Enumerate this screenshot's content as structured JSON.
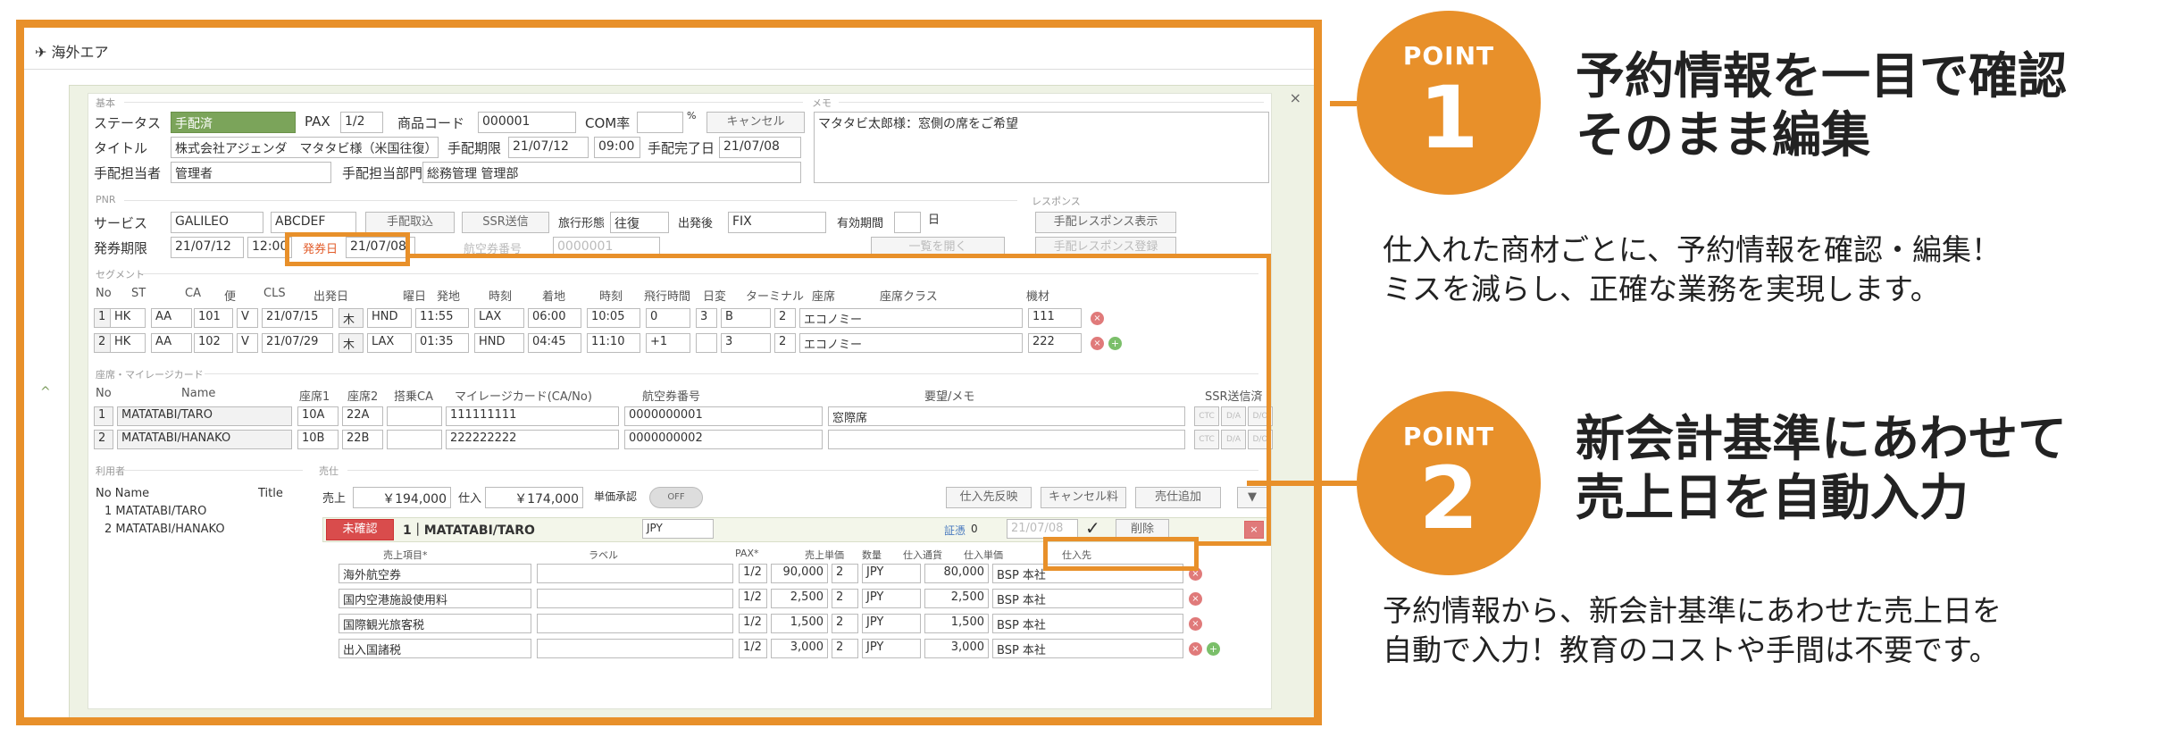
{
  "app": {
    "title": "海外エア",
    "close": "×",
    "collapse": "^"
  },
  "basic": {
    "section": "基本",
    "status_label": "ステータス",
    "status_value": "手配済",
    "pax_label": "PAX",
    "pax_value": "1/2",
    "product_code_label": "商品コード",
    "product_code_value": "000001",
    "com_label": "COM率",
    "com_unit": "%",
    "cancel_button": "キャンセル",
    "title_label": "タイトル",
    "title_value": "株式会社アジェンダ　マタタビ様（米国往復）",
    "deadline_label": "手配期限",
    "deadline_date": "21/07/12",
    "deadline_time": "09:00",
    "done_label": "手配完了日",
    "done_date": "21/07/08",
    "staff_label": "手配担当者",
    "staff_value": "管理者",
    "dept_label": "手配担当部門",
    "dept_value": "総務管理 管理部",
    "memo_section": "メモ",
    "memo_value": "マタタビ太郎様：窓側の席をご希望"
  },
  "pnr": {
    "section": "PNR",
    "service_label": "サービス",
    "service_value": "GALILEO",
    "pnr_code": "ABCDEF",
    "arrange_button": "手配取込",
    "ssr_button": "SSR送信",
    "trip_label": "旅行形態",
    "trip_value": "往復",
    "fare_label": "出発後",
    "fare_value": "FIX",
    "valid_label": "有効期間",
    "valid_unit": "日",
    "issue_label": "発券期限",
    "issue_date": "21/07/12",
    "issue_time": "12:00",
    "hatsu_label": "発券日",
    "hatsu_date": "21/07/08",
    "response_section": "レスポンス",
    "response_button": "手配レスポンス表示",
    "response_register": "手配レスポンス登録",
    "list_button": "一覧を開く",
    "auto_label": "航空券番号",
    "auto_value": "0000001"
  },
  "segment": {
    "section": "セグメント",
    "headers": [
      "No",
      "ST",
      "CA",
      "便",
      "CLS",
      "出発日",
      "曜日",
      "発地",
      "時刻",
      "着地",
      "時刻",
      "飛行時間",
      "日変",
      "ターミナル",
      "座席",
      "座席クラス",
      "機材"
    ],
    "rows": [
      [
        "1",
        "HK",
        "AA",
        "101",
        "V",
        "21/07/15",
        "木",
        "HND",
        "11:55",
        "LAX",
        "06:00",
        "10:05",
        "0",
        "3",
        "B",
        "2",
        "エコノミー",
        "111"
      ],
      [
        "2",
        "HK",
        "AA",
        "102",
        "V",
        "21/07/29",
        "木",
        "LAX",
        "01:35",
        "HND",
        "04:45",
        "11:10",
        "+1",
        "",
        "3",
        "2",
        "エコノミー",
        "222"
      ]
    ]
  },
  "mileage": {
    "section": "座席・マイレージカード",
    "headers": [
      "No",
      "Name",
      "座席1",
      "座席2",
      "搭乗CA",
      "マイレージカード(CA/No)",
      "航空券番号",
      "要望/メモ",
      "SSR送信済"
    ],
    "rows": [
      [
        "1",
        "MATATABI/TARO",
        "10A",
        "22A",
        "",
        "111111111",
        "0000000001",
        "窓際席"
      ],
      [
        "2",
        "MATATABI/HANAKO",
        "10B",
        "22B",
        "",
        "222222222",
        "0000000002",
        ""
      ]
    ],
    "ssr_buttons": [
      "CTC",
      "D/A",
      "D/O"
    ]
  },
  "users": {
    "section": "利用者",
    "headers": [
      "No Name",
      "Title"
    ],
    "rows": [
      "1  MATATABI/TARO",
      "2  MATATABI/HANAKO"
    ]
  },
  "sales": {
    "section": "売仕",
    "sales_label": "売上",
    "sales_value": "￥194,000",
    "cost_label": "仕入",
    "cost_value": "￥174,000",
    "approval_label": "単価承認",
    "toggle": "OFF",
    "btn_supplier": "仕入先反映",
    "btn_cancel_fee": "キャンセル料",
    "btn_add": "売仕追加",
    "unconfirmed": "未確認",
    "passenger": "1｜MATATABI/TARO",
    "currency": "JPY",
    "voucher": "証憑",
    "voucher_val": "0",
    "sales_date": "21/07/08",
    "check": "✓",
    "delete_btn": "削除",
    "headers": [
      "売上項目*",
      "ラベル",
      "PAX*",
      "売上単価",
      "数量",
      "仕入通貨",
      "仕入単価",
      "仕入先"
    ],
    "rows": [
      [
        "海外航空券",
        "",
        "1/2",
        "90,000",
        "2",
        "JPY",
        "80,000",
        "BSP 本社"
      ],
      [
        "国内空港施設使用料",
        "",
        "1/2",
        "2,500",
        "2",
        "JPY",
        "2,500",
        "BSP 本社"
      ],
      [
        "国際観光旅客税",
        "",
        "1/2",
        "1,500",
        "2",
        "JPY",
        "1,500",
        "BSP 本社"
      ],
      [
        "出入国諸税",
        "",
        "1/2",
        "3,000",
        "2",
        "JPY",
        "3,000",
        "BSP 本社"
      ]
    ]
  },
  "points": [
    {
      "label": "POINT",
      "number": "1",
      "heading1": "予約情報を一目で確認",
      "heading2": "そのまま編集",
      "desc1": "仕入れた商材ごとに、予約情報を確認・編集！",
      "desc2": "ミスを減らし、正確な業務を実現します。"
    },
    {
      "label": "POINT",
      "number": "2",
      "heading1": "新会計基準にあわせて",
      "heading2": "売上日を自動入力",
      "desc1": "予約情報から、新会計基準にあわせた売上日を",
      "desc2": "自動で入力！教育のコストや手間は不要です。"
    }
  ],
  "colors": {
    "accent": "#e8902a",
    "status_green": "#7ba45a",
    "danger": "#d94c4c"
  }
}
